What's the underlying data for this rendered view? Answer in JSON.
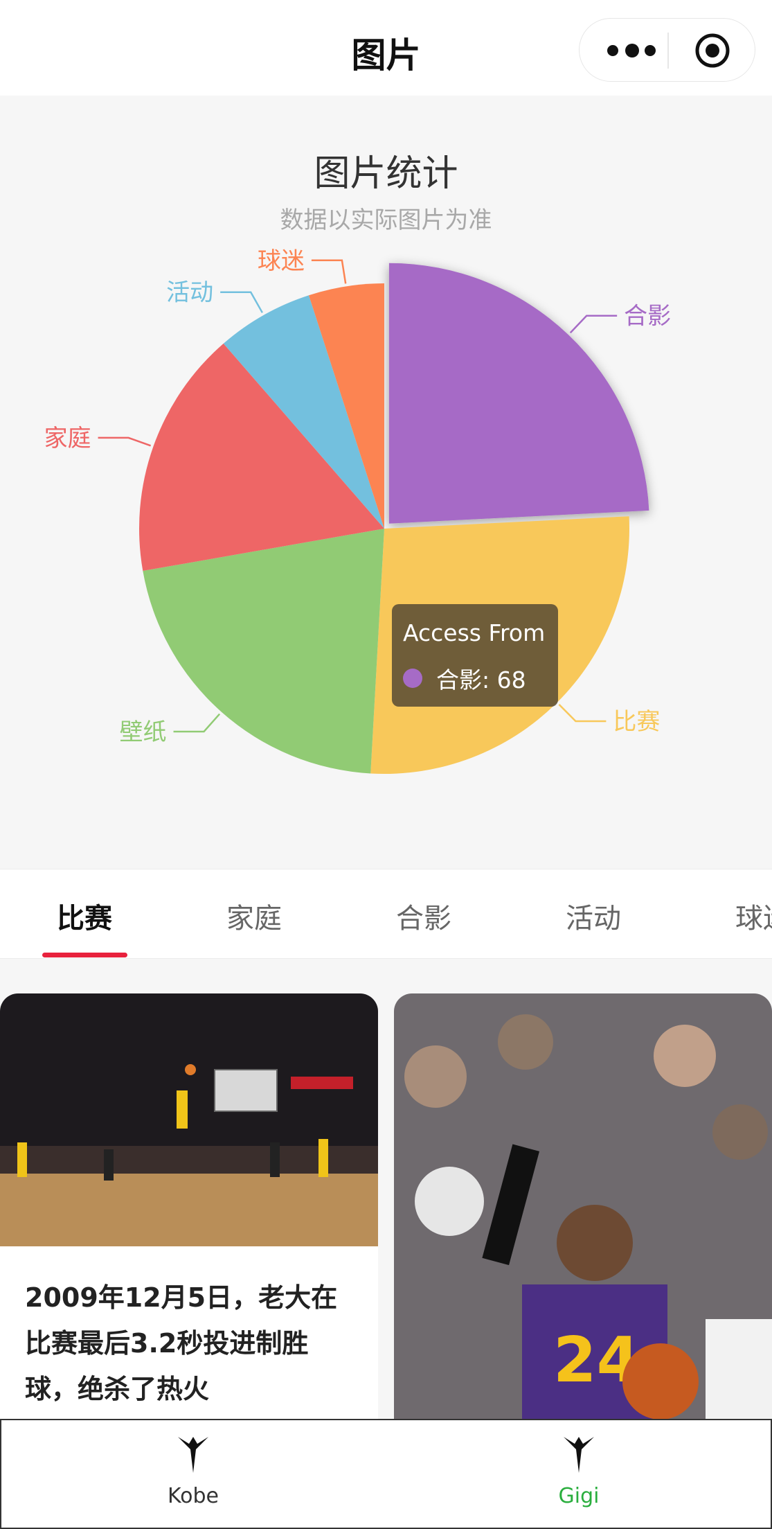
{
  "navbar": {
    "title": "图片"
  },
  "chart_data": {
    "type": "pie",
    "title": "图片统计",
    "subtitle": "数据以实际图片为准",
    "slices": [
      {
        "label": "合影",
        "value": 68,
        "color": "#a66bc6"
      },
      {
        "label": "比赛",
        "value": 75,
        "color": "#f8c85a"
      },
      {
        "label": "壁纸",
        "value": 60,
        "color": "#91cb74"
      },
      {
        "label": "家庭",
        "value": 46,
        "color": "#ee6666"
      },
      {
        "label": "活动",
        "value": 18,
        "color": "#73c0de"
      },
      {
        "label": "球迷",
        "value": 14,
        "color": "#fc8452"
      }
    ],
    "tooltip": {
      "title": "Access From",
      "label": "合影: 68",
      "color": "#a66bc6"
    }
  },
  "tabs": [
    "比赛",
    "家庭",
    "合影",
    "活动",
    "球迷"
  ],
  "cards": [
    {
      "text": "2009年12月5日，老大在比赛最后3.2秒投进制胜球，绝杀了热火"
    },
    {
      "text": ""
    }
  ],
  "tabbar": [
    {
      "label": "Kobe",
      "color": "#333333"
    },
    {
      "label": "Gigi",
      "color": "#2aae3e"
    }
  ]
}
